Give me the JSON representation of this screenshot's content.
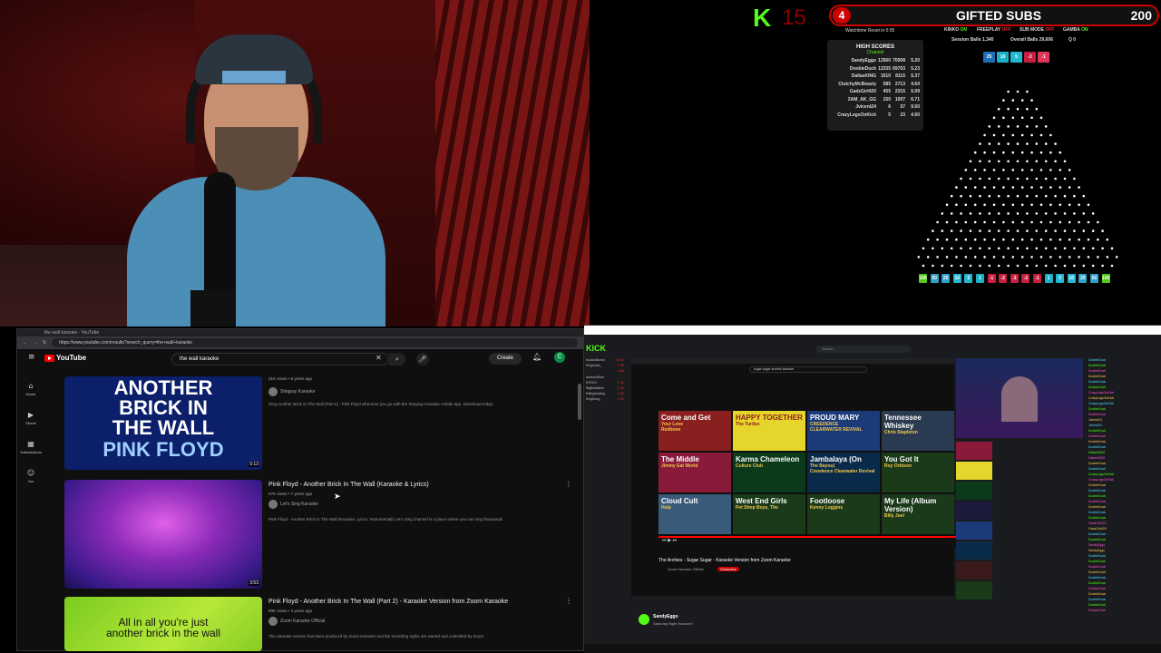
{
  "overlay": {
    "kick_logo": "K",
    "kick_count": "15",
    "gifted_num": "4",
    "gifted_title": "GIFTED SUBS",
    "gifted_total": "200",
    "watchtime": "Watchtime Reset in 0:05",
    "stats_row1": [
      {
        "label": "KINKO",
        "state": "ON"
      },
      {
        "label": "FREEPLAY",
        "state": "OFF"
      },
      {
        "label": "SUB MODE",
        "state": "OFF"
      },
      {
        "label": "GAMBA",
        "state": "ON"
      }
    ],
    "session_balls": "Session Balls  1,340",
    "overall_balls": "Overall Balls  29,606",
    "q_label": "Q  0",
    "high_scores_title": "HIGH SCORES",
    "high_scores_sub": "Channel",
    "high_scores": [
      [
        "SandyEggo",
        "13560",
        "70508",
        "5.20"
      ],
      [
        "DoobleDuck",
        "13335",
        "69703",
        "5.23"
      ],
      [
        "DallasKING",
        "1510",
        "8115",
        "5.37"
      ],
      [
        "ClutchyMcBeasty",
        "585",
        "2713",
        "4.64"
      ],
      [
        "GadzGirl420",
        "455",
        "2315",
        "5.09"
      ],
      [
        "2AM_AK_GG",
        "150",
        "1007",
        "6.71"
      ],
      [
        "Jvicent24",
        "6",
        "57",
        "9.50"
      ],
      [
        "CrazyLegsOnKick",
        "5",
        "23",
        "4.60"
      ]
    ],
    "top_multipliers": [
      "25",
      "10",
      "5",
      "-3",
      "-1"
    ],
    "bottom_multipliers": [
      "100",
      "50",
      "25",
      "10",
      "5",
      "1",
      "-1",
      "-2",
      "-3",
      "-2",
      "-1",
      "1",
      "5",
      "10",
      "25",
      "50",
      "100"
    ],
    "colors": {
      "kick_green": "#53fc18",
      "red": "#cc0000"
    }
  },
  "youtube": {
    "tab_title": "the wall karaoke - YouTube",
    "url": "https://www.youtube.com/results?search_query=the+wall+karaoke",
    "logo": "YouTube",
    "search_value": "the wall karaoke",
    "create_label": "Create",
    "avatar_letter": "C",
    "sidebar": [
      {
        "icon": "⌂",
        "label": "Home"
      },
      {
        "icon": "▶",
        "label": "Shorts"
      },
      {
        "icon": "▦",
        "label": "Subscriptions"
      },
      {
        "icon": "☺",
        "label": "You"
      }
    ],
    "videos": [
      {
        "thumb_text_1": "ANOTHER",
        "thumb_text_2": "BRICK IN",
        "thumb_text_3": "THE WALL",
        "thumb_text_4": "PINK FLOYD",
        "duration": "5:13",
        "meta": "21K views • 6 years ago",
        "channel": "Stingray Karaoke",
        "desc": "Sing Another Brick In The Wall (Part II) : Pink Floyd wherever you go with the Stingray Karaoke mobile app. Download today:"
      },
      {
        "title": "Pink Floyd - Another Brick In The Wall (Karaoke & Lyrics)",
        "duration": "3:53",
        "meta": "57K views • 7 years ago",
        "channel": "Let's Sing Karaoke",
        "desc": "Pink Floyd - Another Brick In The Wall (Karaoke, Lyrics, Instrumental) Let's Sing channel is a place where you can sing thousands"
      },
      {
        "title": "Pink Floyd - Another Brick In The Wall (Part 2) - Karaoke Version from Zoom Karaoke",
        "thumb_text_1": "All in all you're just",
        "thumb_text_2": "another brick in the wall",
        "meta": "89K views • 4 years ago",
        "channel": "Zoom Karaoke Official",
        "desc": "This karaoke version has been produced by Zoom Karaoke and the recording rights are owned and controlled by Zoom"
      }
    ]
  },
  "kick": {
    "logo": "KICK",
    "search": "Search",
    "inner_search": "sugar sugar archies karaoke",
    "player_title": "The Archies - Sugar Sugar - Karaoke Version from Zoom Karaoke",
    "channel_name": "Zoom Karaoke Official",
    "subscribe": "Subscribe",
    "streamer": "SandyEggo",
    "streamer_sub": "Saturday Night Karaoke!",
    "grid": [
      {
        "t1": "Come and Get",
        "t2": "Your Love",
        "t3": "Redbone",
        "bg": "#8a1f1f"
      },
      {
        "t1": "HAPPY TOGETHER",
        "t2": "The Turtles",
        "t3": "",
        "bg": "#e6d52a"
      },
      {
        "t1": "PROUD MARY",
        "t2": "CREEDENCE",
        "t3": "CLEARWATER REVIVAL",
        "bg": "#1b3a7a"
      },
      {
        "t1": "Tennessee Whiskey",
        "t2": "Chris Stapleton",
        "t3": "",
        "bg": "#2a3a50"
      },
      {
        "t1": "The Middle",
        "t2": "Jimmy Eat World",
        "t3": "",
        "bg": "#8a1a3a"
      },
      {
        "t1": "Karma Chameleon",
        "t2": "Culture Club",
        "t3": "",
        "bg": "#0a3a1a"
      },
      {
        "t1": "Jambalaya (On",
        "t2": "The Bayou)",
        "t3": "Creedence Clearwater Revival",
        "bg": "#0a2a4a"
      },
      {
        "t1": "You Got It",
        "t2": "Roy Orbison",
        "t3": "",
        "bg": "#1a3a1a"
      },
      {
        "t1": "Cloud Cult",
        "t2": "Help",
        "t3": "",
        "bg": "#3a5a7a"
      },
      {
        "t1": "West End Girls",
        "t2": "Pet Shop Boys, The",
        "t3": "",
        "bg": "#1a3a1a"
      },
      {
        "t1": "Footloose",
        "t2": "Kenny Loggins",
        "t3": "",
        "bg": "#1a3a1a"
      },
      {
        "t1": "My Life (Album Version)",
        "t2": "Billy Joel",
        "t3": "",
        "bg": "#1a3a1a"
      }
    ],
    "channels": [
      [
        "ItsJackBurton",
        "",
        "10.9K"
      ],
      [
        "Kingshark_",
        "",
        "7.4K"
      ],
      [
        "",
        "",
        "4.8K"
      ],
      [
        "AmbushSam",
        "",
        ""
      ],
      [
        "5TROG",
        "",
        "1.4K"
      ],
      [
        "BigBallsBear",
        "",
        "1.3K"
      ],
      [
        "fellingwhaling",
        "",
        "1.2K"
      ],
      [
        "KingDong",
        "",
        "1.1K"
      ]
    ],
    "chat": [
      "DoobleDuck",
      "DoobleDuck",
      "DoobleDuck",
      "DoobleDuck",
      "DoobleDuck",
      "DoobleDuck",
      "CrazyLegsOnKick",
      "CrazyLegsOnKick",
      "CrazyLegsOnKick",
      "DoobleDuck",
      "DoobleDuck",
      "Jvicent24",
      "Jvicent24",
      "DoobleDuck",
      "DoobleDuck",
      "DoobleDuck",
      "DoobleDuck",
      "DallasKING",
      "DallasKING",
      "DoobleDuck",
      "DoobleDuck",
      "CrazyLegsOnKick",
      "CrazyLegsOnKick",
      "DoobleDuck",
      "DoobleDuck",
      "DoobleDuck",
      "DoobleDuck",
      "DoobleDuck",
      "DoobleDuck",
      "DoobleDuck",
      "GadzGirl420",
      "GadzGirl420",
      "DoobleDuck",
      "DoobleDuck",
      "SandyEggo",
      "SandyEggo",
      "DoobleDuck",
      "DoobleDuck",
      "DoobleDuck",
      "DoobleDuck",
      "DoobleDuck",
      "DoobleDuck",
      "DoobleDuck",
      "DoobleDuck",
      "DoobleDuck",
      "DoobleDuck",
      "DoobleDuck"
    ]
  }
}
